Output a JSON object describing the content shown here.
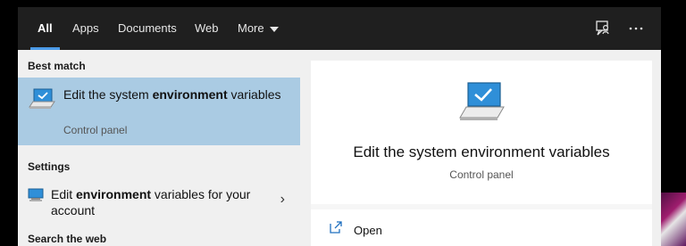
{
  "tabs": [
    {
      "label": "All"
    },
    {
      "label": "Apps"
    },
    {
      "label": "Documents"
    },
    {
      "label": "Web"
    },
    {
      "label": "More"
    }
  ],
  "sections": {
    "best_match": "Best match",
    "settings": "Settings",
    "search_web": "Search the web"
  },
  "best_match_item": {
    "title_before": "Edit the system ",
    "title_bold": "environment",
    "title_after": " variables",
    "subtitle": "Control panel"
  },
  "settings_item": {
    "before": "Edit ",
    "bold": "environment",
    "after": " variables for your account"
  },
  "preview": {
    "title": "Edit the system environment variables",
    "subtitle": "Control panel",
    "action_open": "Open"
  },
  "icons": {
    "feedback": "feedback-icon",
    "more": "more-options-icon",
    "control_panel": "monitor-icon",
    "open": "open-icon",
    "chevron": "chevron-right-icon"
  },
  "colors": {
    "topbar": "#1f1f1f",
    "selected": "#aacbe3",
    "accent": "#4c9be8"
  }
}
